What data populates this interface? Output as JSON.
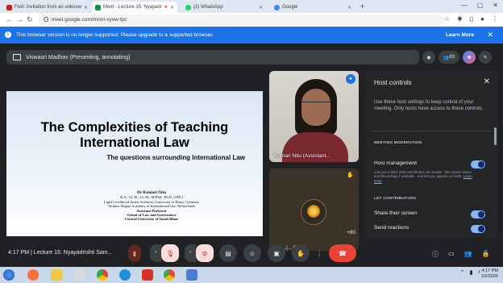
{
  "tabs": [
    {
      "title": "Fwd: Invitation from an unknow",
      "color": "#c5221f"
    },
    {
      "title": "Meet - Lecture 15: Nyayadr",
      "color": "#1e8e3e"
    },
    {
      "title": "(2) WhatsApp",
      "color": "#25d366"
    },
    {
      "title": "Google",
      "color": "#4285f4"
    }
  ],
  "address": {
    "url": "meet.google.com/mnm-vyvw-tpc"
  },
  "infobar": {
    "message": "This browser version is no longer supported. Please upgrade to a supported browser.",
    "learn_more": "Learn More"
  },
  "meet": {
    "presenter": "Viswasri Madhav (Presenting, annotating)",
    "participant_count": "83",
    "tile1_name": "Kumari Nitu (Assistant...",
    "tile2_count": "+80",
    "tile2_name": "...(... C...",
    "time": "4:17 PM",
    "meeting_name": "Lecture 15: Nyayadrishti Sam..."
  },
  "slide": {
    "title_line1": "The Complexities of Teaching",
    "title_line2": "International Law",
    "subtitle": "The questions surrounding International Law",
    "author_name": "Dr Kumari Nitu",
    "author_lines": [
      "B.A., LL.B., LL.M., M.Phil., Ph.D. (JNU)",
      "Light Livelihood Junior Scientist, University of Bonn, Germany",
      "Alumni, Hague Academy of International law, Netherlands"
    ],
    "author_role_lines": [
      "Assistant Professor",
      "School of Law and Governance",
      "Central University of South Bihar"
    ]
  },
  "host_controls": {
    "title": "Host controls",
    "description": "Use these host settings to keep control of your meeting. Only hosts have access to these controls.",
    "section_moderation": "MEETING MODERATION",
    "host_management": "Host management",
    "host_management_desc": "Lets you restrict what contributors can enable - like Gemini Notes and Recordings if available - and lets you appoint co-hosts.",
    "learn_more": "Learn more",
    "section_contributors": "LET CONTRIBUTORS",
    "share_screen": "Share their screen",
    "send_reactions": "Send reactions"
  },
  "taskbar": {
    "time": "4:17 PM",
    "date": "1/2/2026"
  },
  "colors": {
    "accent": "#1a73e8",
    "end_call": "#ea4335",
    "toggle_on": "#8ab4f8"
  }
}
